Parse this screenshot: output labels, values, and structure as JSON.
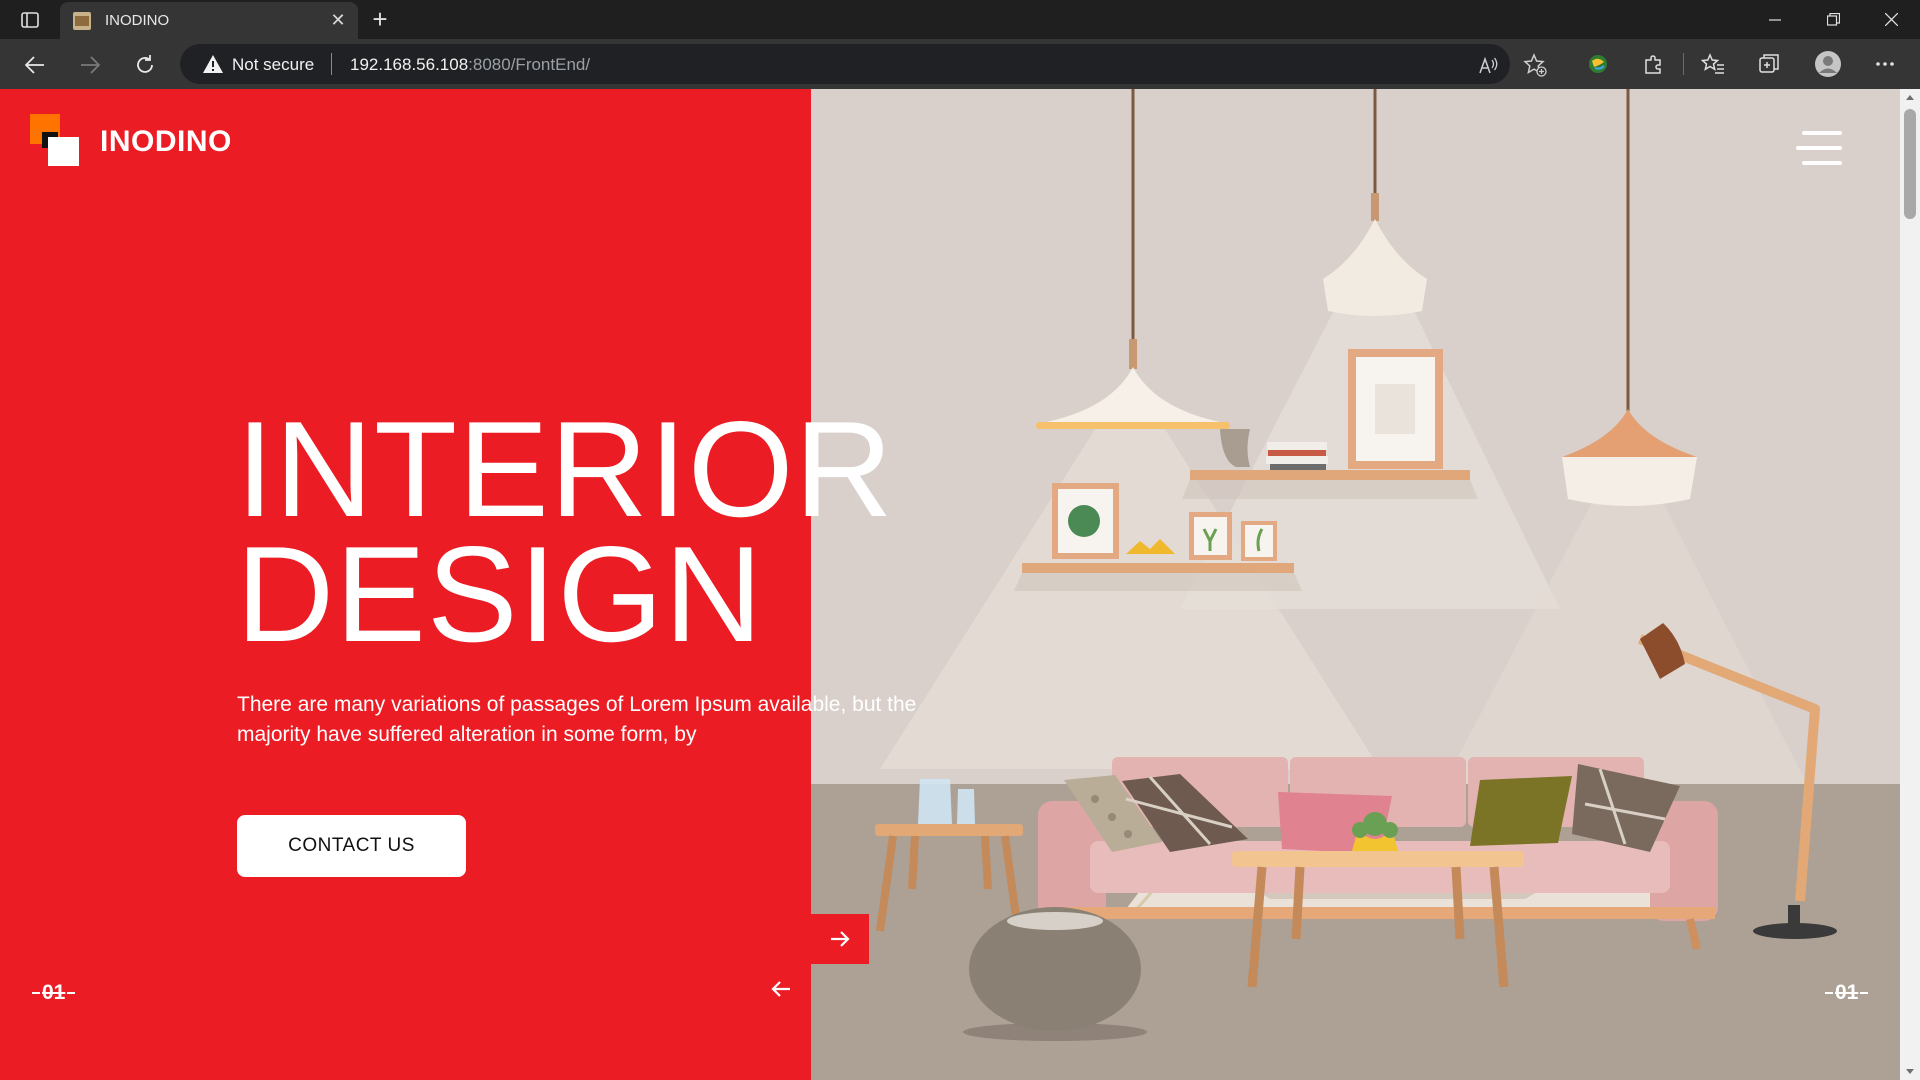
{
  "browser": {
    "tab_title": "INODINO",
    "close_tab": "✕",
    "new_tab": "+",
    "security_label": "Not secure",
    "url_host": "192.168.56.108",
    "url_rest": ":8080/FrontEnd/"
  },
  "site": {
    "brand": "INODINO",
    "colors": {
      "accent": "#ec1c24",
      "logo_orange": "#ff7300"
    }
  },
  "hero": {
    "title": "INTERIOR\nDESIGN",
    "text": "There are many variations of passages of Lorem Ipsum available, but the majority have suffered alteration in some form, by",
    "cta_label": "CONTACT US"
  },
  "slider": {
    "left_counter": "01",
    "right_counter": "01"
  }
}
